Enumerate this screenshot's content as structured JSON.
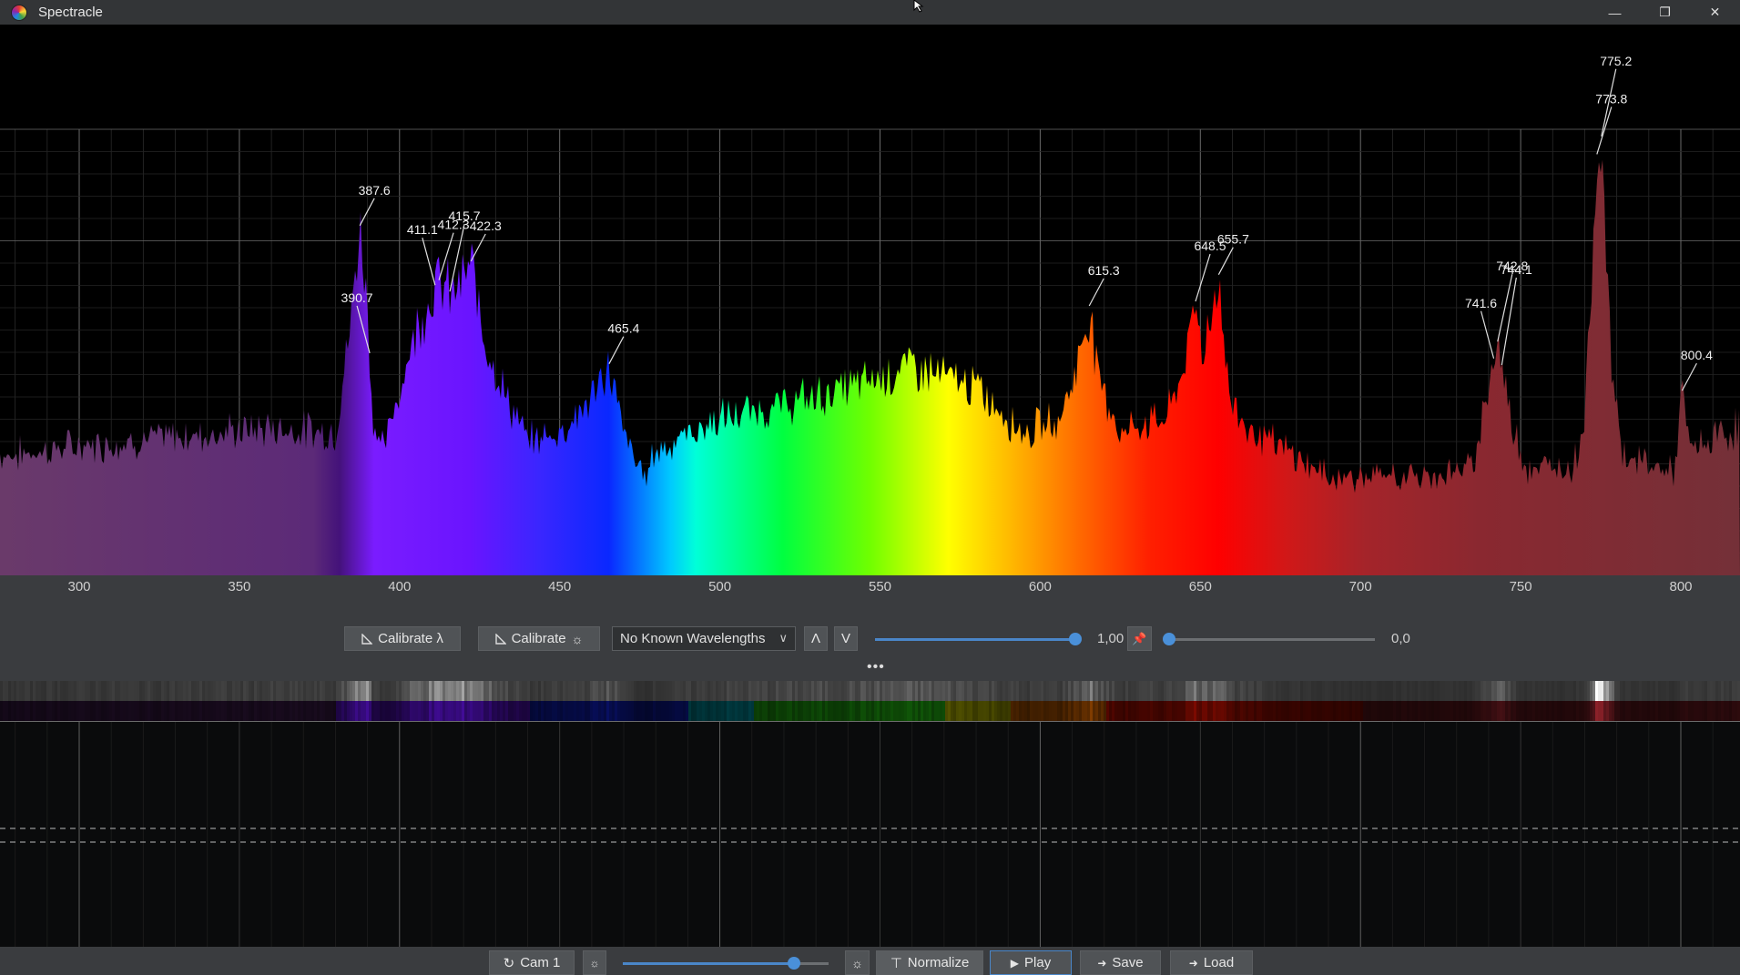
{
  "window": {
    "title": "Spectracle"
  },
  "controls": {
    "calibrate_lambda": "Calibrate λ",
    "calibrate_intensity": "Calibrate",
    "known_wavelengths": "No Known Wavelengths",
    "arrow_up": "Λ",
    "arrow_down": "V",
    "gain_value": "1,00",
    "offset_value": "0,0",
    "gain_level": 0.98,
    "offset_level": 0.0
  },
  "bottombar": {
    "camera": "Cam 1",
    "normalize": "Normalize",
    "play": "Play",
    "save": "Save",
    "load": "Load",
    "exposure_level": 0.83
  },
  "chart_data": {
    "type": "area",
    "xlabel": "",
    "ylabel": "",
    "xlim": [
      280,
      820
    ],
    "x_ticks": [
      "300",
      "350",
      "400",
      "450",
      "500",
      "550",
      "600",
      "650",
      "700",
      "750",
      "800"
    ],
    "peaks": [
      {
        "label": "387.6",
        "x": 387.6
      },
      {
        "label": "390.7",
        "x": 390.7
      },
      {
        "label": "411.1",
        "x": 411.1
      },
      {
        "label": "412.3",
        "x": 412.3
      },
      {
        "label": "415.7",
        "x": 415.7
      },
      {
        "label": "422.3",
        "x": 422.3
      },
      {
        "label": "465.4",
        "x": 465.4
      },
      {
        "label": "615.3",
        "x": 615.3
      },
      {
        "label": "648.5",
        "x": 648.5
      },
      {
        "label": "655.7",
        "x": 655.7
      },
      {
        "label": "741.6",
        "x": 741.6
      },
      {
        "label": "742.8",
        "x": 742.8
      },
      {
        "label": "744.1",
        "x": 744.1
      },
      {
        "label": "773.8",
        "x": 773.8
      },
      {
        "label": "775.2",
        "x": 775.2
      },
      {
        "label": "800.4",
        "x": 800.4
      }
    ],
    "profile_x": [
      280,
      300,
      330,
      360,
      380,
      384,
      387.6,
      390,
      391.5,
      395,
      405,
      410,
      412,
      416,
      420,
      422.3,
      426,
      432,
      440,
      450,
      458,
      462,
      465.4,
      470,
      476,
      480,
      500,
      520,
      540,
      560,
      580,
      595,
      606,
      612,
      615.3,
      618,
      625,
      640,
      646,
      648.5,
      651,
      655.7,
      659,
      665,
      690,
      720,
      735,
      739,
      742.8,
      747,
      752,
      766,
      770,
      773.8,
      775.2,
      778,
      782,
      798,
      800.4,
      803,
      820
    ],
    "profile_y": [
      0.27,
      0.29,
      0.31,
      0.33,
      0.32,
      0.52,
      0.78,
      0.62,
      0.35,
      0.28,
      0.55,
      0.63,
      0.66,
      0.63,
      0.66,
      0.7,
      0.55,
      0.42,
      0.3,
      0.32,
      0.38,
      0.42,
      0.47,
      0.32,
      0.22,
      0.28,
      0.35,
      0.38,
      0.42,
      0.47,
      0.42,
      0.32,
      0.35,
      0.48,
      0.6,
      0.45,
      0.32,
      0.36,
      0.5,
      0.61,
      0.5,
      0.67,
      0.4,
      0.33,
      0.22,
      0.22,
      0.24,
      0.4,
      0.52,
      0.35,
      0.24,
      0.24,
      0.35,
      0.94,
      0.98,
      0.5,
      0.27,
      0.23,
      0.41,
      0.28,
      0.34
    ]
  },
  "colors": {
    "background": "#000000",
    "panel": "#3a3c3f",
    "accent": "#4a90d9",
    "grid": "#5a5a5a"
  }
}
